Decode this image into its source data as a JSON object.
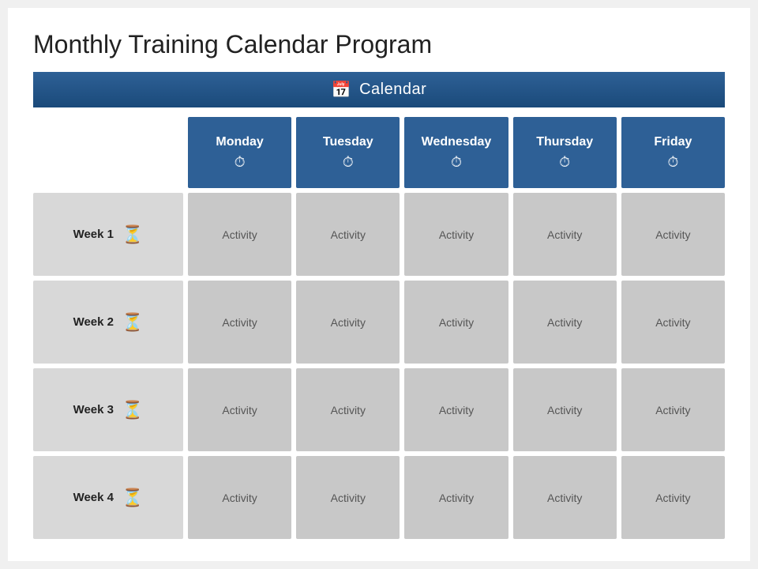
{
  "slide": {
    "title": "Monthly Training Calendar Program",
    "calendar_header": "Calendar",
    "days": [
      "Monday",
      "Tuesday",
      "Wednesday",
      "Thursday",
      "Friday"
    ],
    "weeks": [
      "Week 1",
      "Week 2",
      "Week 3",
      "Week 4"
    ],
    "activity_label": "Activity",
    "colors": {
      "header_bg": "#2e6096",
      "week_bg": "#d8d8d8",
      "activity_bg": "#c8c8c8"
    }
  }
}
